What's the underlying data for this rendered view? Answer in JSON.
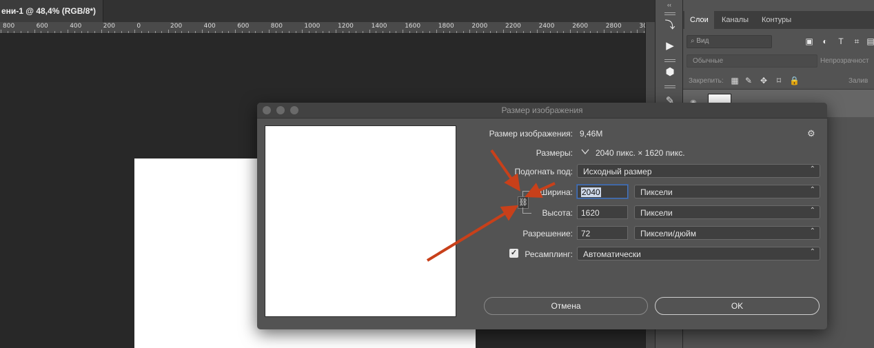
{
  "document": {
    "tab_title": "ени-1 @ 48,4% (RGB/8*)"
  },
  "ruler": {
    "labels": [
      "800",
      "600",
      "400",
      "200",
      "0",
      "200",
      "400",
      "600",
      "800",
      "1000",
      "1200",
      "1400",
      "1600",
      "1800",
      "2000",
      "2200",
      "2400",
      "2600",
      "2800",
      "30"
    ]
  },
  "tools_panel": {
    "collapse_label": "‹‹"
  },
  "layers_panel": {
    "tabs": [
      "Слои",
      "Каналы",
      "Контуры"
    ],
    "filter_placeholder": "Вид",
    "blend_mode": "Обычные",
    "opacity_label": "Непрозрачност",
    "lock_label": "Закрепить:",
    "fill_label": "Залив"
  },
  "dialog": {
    "title": "Размер изображения",
    "image_size_label": "Размер изображения:",
    "image_size_value": "9,46M",
    "dimensions_label": "Размеры:",
    "dimensions_width": "2040 пикс.",
    "dimensions_sep": "×",
    "dimensions_height": "1620 пикс.",
    "fit_to_label": "Подогнать под:",
    "fit_to_value": "Исходный размер",
    "width_label": "Ширина:",
    "width_value": "2040",
    "width_unit": "Пиксели",
    "height_label": "Высота:",
    "height_value": "1620",
    "height_unit": "Пиксели",
    "resolution_label": "Разрешение:",
    "resolution_value": "72",
    "resolution_unit": "Пиксели/дюйм",
    "resample_label": "Ресамплинг:",
    "resample_checked": true,
    "resample_value": "Автоматически",
    "cancel_label": "Отмена",
    "ok_label": "OK"
  },
  "colors": {
    "annotation_arrow": "#c8401a",
    "focus_ring": "#4c76b8"
  }
}
